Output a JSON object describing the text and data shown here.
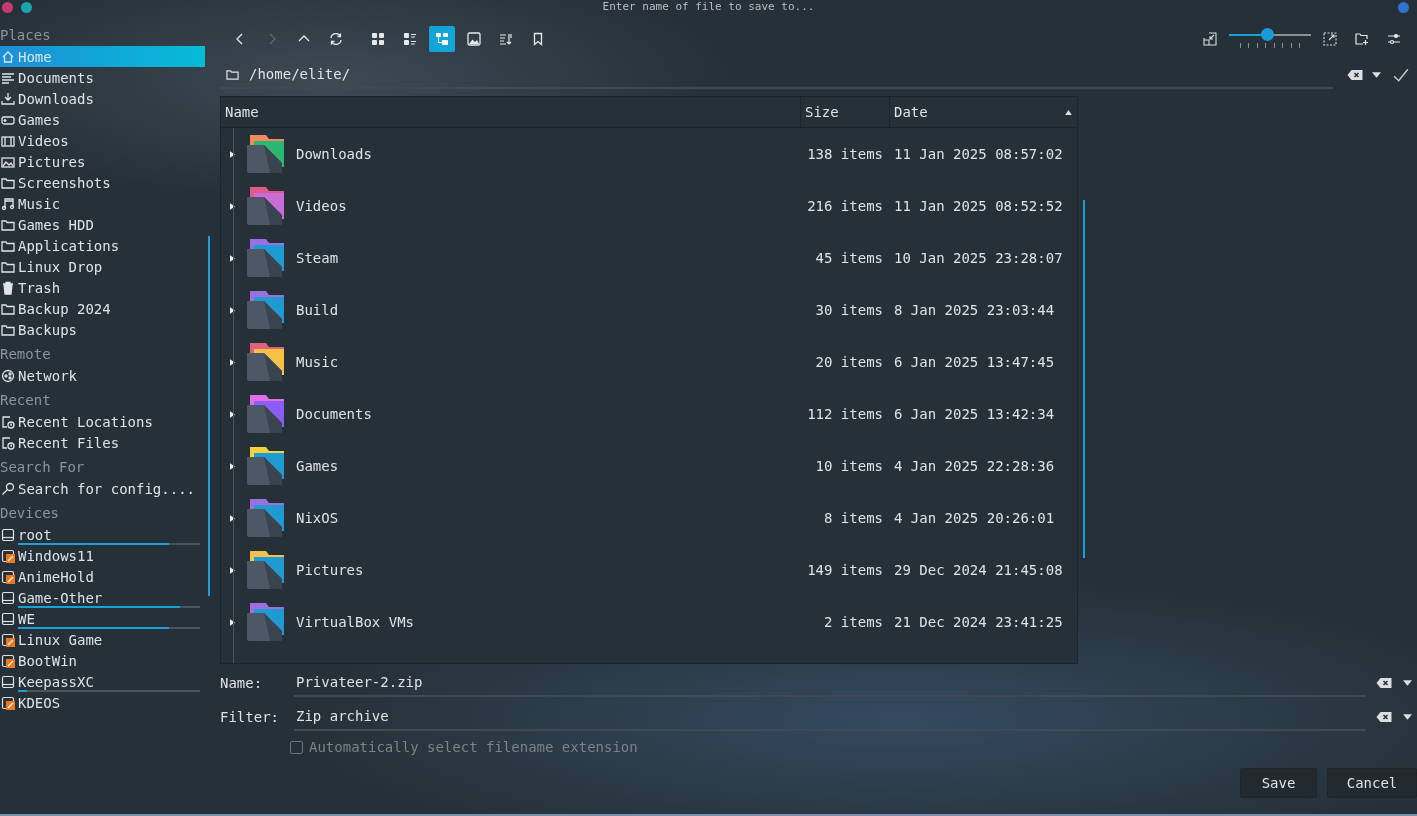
{
  "window": {
    "title": "Enter name of file to save to..."
  },
  "sidebar": {
    "sections": [
      {
        "title": "Places",
        "items": [
          {
            "label": "Home",
            "selected": true
          },
          {
            "label": "Documents",
            "selected": false
          },
          {
            "label": "Downloads",
            "selected": false
          },
          {
            "label": "Games",
            "selected": false
          },
          {
            "label": "Videos",
            "selected": false
          },
          {
            "label": "Pictures",
            "selected": false
          },
          {
            "label": "Screenshots",
            "selected": false
          },
          {
            "label": "Music",
            "selected": false
          },
          {
            "label": "Games HDD",
            "selected": false
          },
          {
            "label": "Applications",
            "selected": false
          },
          {
            "label": "Linux Drop",
            "selected": false
          },
          {
            "label": "Trash",
            "selected": false
          },
          {
            "label": "Backup 2024",
            "selected": false
          },
          {
            "label": "Backups",
            "selected": false
          }
        ]
      },
      {
        "title": "Remote",
        "items": [
          {
            "label": "Network",
            "selected": false
          }
        ]
      },
      {
        "title": "Recent",
        "items": [
          {
            "label": "Recent Locations",
            "selected": false
          },
          {
            "label": "Recent Files",
            "selected": false
          }
        ]
      },
      {
        "title": "Search For",
        "items": [
          {
            "label": "Search for config....",
            "selected": false
          }
        ]
      }
    ],
    "devices": {
      "title": "Devices",
      "items": [
        {
          "label": "root",
          "kind": "mounted",
          "level": 0.83
        },
        {
          "label": "Windows11",
          "kind": "unmounted"
        },
        {
          "label": "AnimeHold",
          "kind": "unmounted"
        },
        {
          "label": "Game-Other",
          "kind": "mounted",
          "level": 0.89
        },
        {
          "label": "WE",
          "kind": "mounted",
          "level": 0.83
        },
        {
          "label": "Linux Game",
          "kind": "unmounted"
        },
        {
          "label": "BootWin",
          "kind": "unmounted"
        },
        {
          "label": "KeepassXC",
          "kind": "mounted",
          "level": 0.05
        },
        {
          "label": "KDEOS",
          "kind": "unmounted"
        }
      ]
    }
  },
  "toolbar": {
    "forward_disabled": true,
    "view_modes": [
      {
        "selected": false
      },
      {
        "selected": false
      },
      {
        "selected": true
      }
    ],
    "zoom": {
      "level": 0.46
    }
  },
  "location": {
    "path": "/home/elite/"
  },
  "table": {
    "columns": [
      {
        "label": "Name",
        "sorted": false
      },
      {
        "label": "Size",
        "sorted": false
      },
      {
        "label": "Date",
        "sorted": true
      }
    ],
    "rows": [
      {
        "name": "Downloads",
        "size": "138 items",
        "date": "11 Jan 2025 08:57:02"
      },
      {
        "name": "Videos",
        "size": "216 items",
        "date": "11 Jan 2025 08:52:52"
      },
      {
        "name": "Steam",
        "size": "45 items",
        "date": "10 Jan 2025 23:28:07"
      },
      {
        "name": "Build",
        "size": "30 items",
        "date": "8 Jan 2025 23:03:44"
      },
      {
        "name": "Music",
        "size": "20 items",
        "date": "6 Jan 2025 13:47:45"
      },
      {
        "name": "Documents",
        "size": "112 items",
        "date": "6 Jan 2025 13:42:34"
      },
      {
        "name": "Games",
        "size": "10 items",
        "date": "4 Jan 2025 22:28:36"
      },
      {
        "name": "NixOS",
        "size": "8 items",
        "date": "4 Jan 2025 20:26:01"
      },
      {
        "name": "Pictures",
        "size": "149 items",
        "date": "29 Dec 2024 21:45:08"
      },
      {
        "name": "VirtualBox VMs",
        "size": "2 items",
        "date": "21 Dec 2024 23:41:25"
      }
    ]
  },
  "name_field": {
    "label": "Name:",
    "value": "Privateer-2.zip"
  },
  "filter_field": {
    "label": "Filter:",
    "value": "Zip archive"
  },
  "auto_extension": {
    "label": "Automatically select filename extension",
    "checked": false,
    "disabled": true
  },
  "buttons": [
    "Save",
    "Cancel"
  ]
}
